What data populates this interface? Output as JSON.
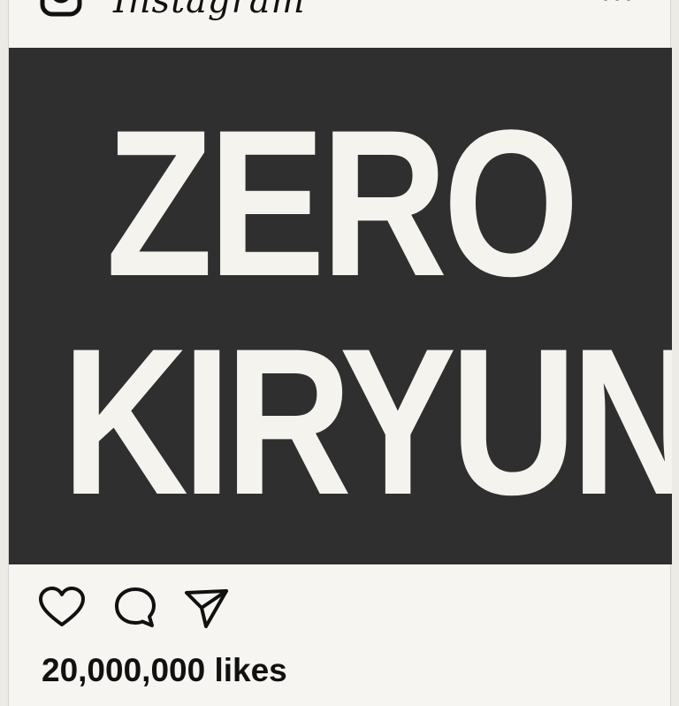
{
  "header": {
    "app_name": "Instagram",
    "logo_icon": "instagram-camera-icon",
    "menu_icon": "more-options-icon"
  },
  "post": {
    "image_text": {
      "line1": "ZERO",
      "line2": "KIRYUN"
    },
    "colors": {
      "image_background": "#2f2f2f",
      "image_text": "#f5f3ee",
      "card_background": "#f6f5f1"
    },
    "actions": [
      {
        "name": "like",
        "icon": "heart-icon"
      },
      {
        "name": "comment",
        "icon": "comment-icon"
      },
      {
        "name": "share",
        "icon": "send-icon"
      }
    ],
    "likes_text": "20,000,000 likes"
  }
}
